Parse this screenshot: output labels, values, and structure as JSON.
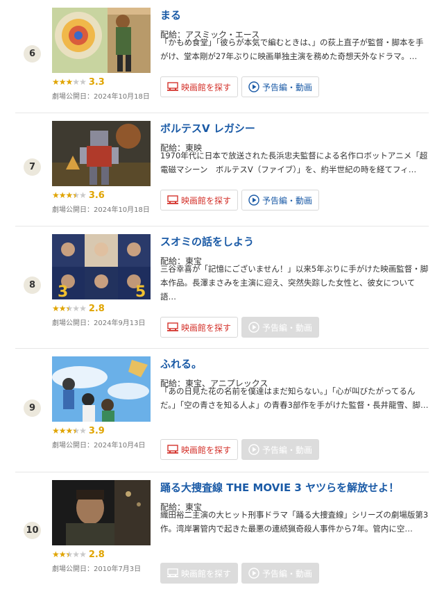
{
  "buttons": {
    "theater_label": "映画館を探す",
    "trailer_label": "予告編・動画"
  },
  "colors": {
    "link": "#1a5aa6",
    "accent_red": "#d4332c",
    "star": "#e0a400"
  },
  "movies": [
    {
      "rank": "6",
      "title": "まる",
      "distributor": "配給：アスミック・エース",
      "description": "「かもめ食堂」「彼らが本気で編むときは、」の荻上直子が監督・脚本を手がけ、堂本剛が27年ぶりに映画単独主演を務めた奇想天外なドラマ。…",
      "rating_score": "3.3",
      "rating_value": 3.3,
      "release": "劇場公開日：2024年10月18日",
      "theater_enabled": true,
      "trailer_enabled": true,
      "poster_icon": "painting-artist-image"
    },
    {
      "rank": "7",
      "title": "ボルテスV レガシー",
      "distributor": "配給：東映",
      "description": "1970年代に日本で放送された長浜忠夫監督による名作ロボットアニメ「超電磁マシーン　ボルテスV（ファイブ）」を、約半世紀の時を経てフィ…",
      "rating_score": "3.6",
      "rating_value": 3.6,
      "release": "劇場公開日：2024年10月18日",
      "theater_enabled": true,
      "trailer_enabled": true,
      "poster_icon": "robot-image"
    },
    {
      "rank": "8",
      "title": "スオミの話をしよう",
      "distributor": "配給：東宝",
      "description": "三谷幸喜が「記憶にございません！」以来5年ぶりに手がけた映画監督・脚本作品。長澤まさみを主演に迎え、突然失踪した女性と、彼女について語…",
      "rating_score": "2.8",
      "rating_value": 2.8,
      "release": "劇場公開日：2024年9月13日",
      "theater_enabled": true,
      "trailer_enabled": false,
      "poster_icon": "cast-grid-image"
    },
    {
      "rank": "9",
      "title": "ふれる。",
      "distributor": "配給：東宝、アニプレックス",
      "description": "「あの日見た花の名前を僕達はまだ知らない。」「心が叫びたがってるんだ。」「空の青さを知る人よ」の青春3部作を手がけた監督・長井龍雪、脚…",
      "rating_score": "3.9",
      "rating_value": 3.9,
      "release": "劇場公開日：2024年10月4日",
      "theater_enabled": true,
      "trailer_enabled": false,
      "poster_icon": "anime-sky-image"
    },
    {
      "rank": "10",
      "title": "踊る大捜査線 THE MOVIE 3 ヤツらを解放せよ！",
      "distributor": "配給：東宝",
      "description": "織田裕二主演の大ヒット刑事ドラマ「踊る大捜査線」シリーズの劇場版第3作。湾岸署管内で起きた最悪の連続猟奇殺人事件から7年。管内に空…",
      "rating_score": "2.8",
      "rating_value": 2.8,
      "release": "劇場公開日：2010年7月3日",
      "theater_enabled": false,
      "trailer_enabled": false,
      "poster_icon": "detective-portrait-image"
    }
  ]
}
